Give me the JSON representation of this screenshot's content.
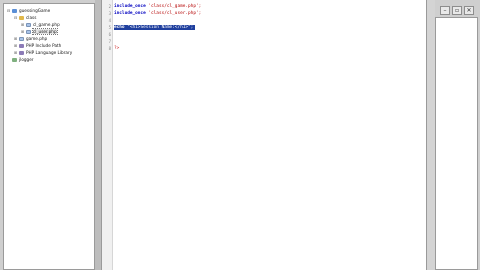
{
  "project_tree": {
    "items": [
      {
        "toggle": "⊟",
        "icon": "project-icon",
        "label": "guessingGame"
      },
      {
        "toggle": "⊟",
        "icon": "folder-icon",
        "label": "class"
      },
      {
        "toggle": "⊞",
        "icon": "php-file-icon",
        "label": "cl_game.php"
      },
      {
        "toggle": "⊞",
        "icon": "php-file-icon",
        "label": "cl_user.php"
      },
      {
        "toggle": "⊞",
        "icon": "php-file-icon",
        "label": "game.php"
      },
      {
        "toggle": "⊞",
        "icon": "library-icon",
        "label": "PHP Include Path"
      },
      {
        "toggle": "⊞",
        "icon": "library-icon",
        "label": "PHP Language Library"
      },
      {
        "toggle": "",
        "icon": "logger-icon",
        "label": "jlogger"
      }
    ],
    "selected_index": 3
  },
  "editor": {
    "line_numbers": [
      "2",
      "3",
      "4",
      "5",
      "6",
      "7",
      "8"
    ],
    "lines": [
      {
        "kw": "include_once",
        "str": " 'class/cl_game.php';"
      },
      {
        "kw": "include_once",
        "str": " 'class/cl_user.php';"
      },
      {
        "kw": "",
        "str": ""
      },
      {
        "kw": "echo",
        "str": " \"<h1>Session Name:</h1>\";"
      },
      {
        "kw": "",
        "str": ""
      },
      {
        "kw": "",
        "str": ""
      },
      {
        "kw": "",
        "str": ""
      }
    ],
    "php_close": "?>"
  },
  "window_controls": {
    "minimize": "–",
    "restore": "▫",
    "close": "✕"
  }
}
